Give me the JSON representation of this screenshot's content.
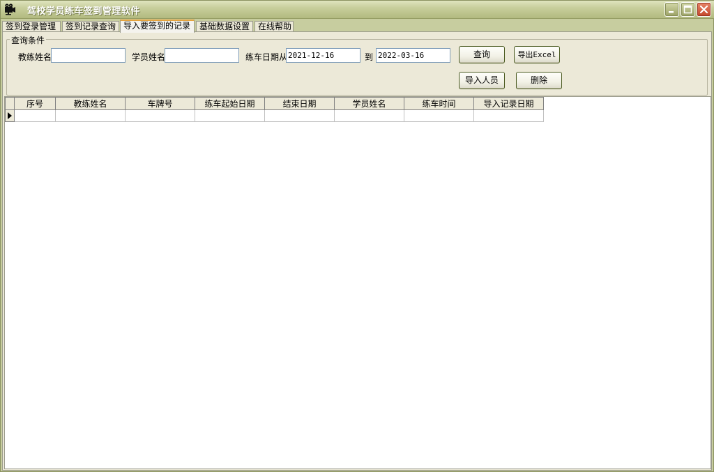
{
  "window": {
    "title": "驾校学员练车签到管理软件"
  },
  "tabs": [
    {
      "label": "签到登录管理",
      "active": false
    },
    {
      "label": "签到记录查询",
      "active": false
    },
    {
      "label": "导入要签到的记录",
      "active": true
    },
    {
      "label": "基础数据设置",
      "active": false
    },
    {
      "label": "在线帮助",
      "active": false
    }
  ],
  "query": {
    "group_title": "查询条件",
    "coach_label": "教练姓名",
    "coach_value": "",
    "student_label": "学员姓名",
    "student_value": "",
    "date_label": "练车日期从",
    "date_from": "2021-12-16",
    "to_label": "到",
    "date_to": "2022-03-16",
    "query_button": "查询",
    "export_button": "导出Excel",
    "import_button": "导入人员",
    "delete_button": "删除"
  },
  "grid": {
    "columns": [
      "序号",
      "教练姓名",
      "车牌号",
      "练车起始日期",
      "结束日期",
      "学员姓名",
      "练车时间",
      "导入记录日期"
    ],
    "rows": [
      [
        "",
        "",
        "",
        "",
        "",
        "",
        "",
        ""
      ]
    ]
  },
  "icons": {
    "app": "film-camera-icon",
    "minimize": "minimize-icon",
    "maximize": "maximize-icon",
    "close": "close-icon",
    "row_indicator": "current-row-arrow-icon"
  },
  "colors": {
    "titlebar": "#c8cf9c",
    "face": "#ece9d8",
    "close_button": "#c3472a",
    "active_tab_accent": "#e4a33e"
  }
}
